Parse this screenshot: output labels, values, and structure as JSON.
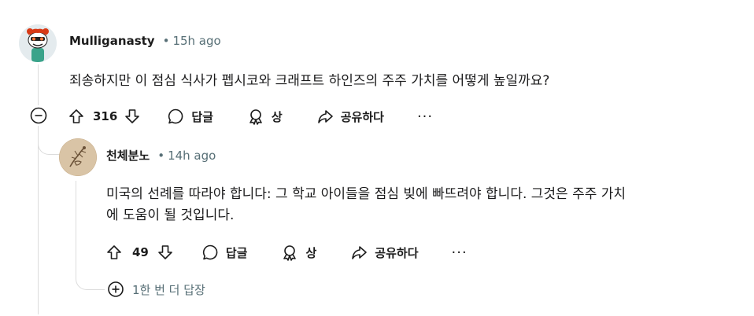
{
  "comment": {
    "author": "Mulliganasty",
    "time": "15h ago",
    "text": "죄송하지만 이 점심 식사가 펩시코와 크래프트 하인즈의 주주 가치를 어떻게 높일까요?",
    "votes": "316",
    "actions": {
      "reply": "답글",
      "award": "상",
      "share": "공유하다",
      "more": "···"
    }
  },
  "reply": {
    "author": "천체분노",
    "time": "14h ago",
    "text_line1": "미국의 선례를 따라야 합니다: 그 학교 아이들을 점심 빚에 빠뜨려야 합니다. 그것은 주주 가치",
    "text_line2": "에 도움이 될 것입니다.",
    "votes": "49",
    "actions": {
      "reply": "답글",
      "award": "상",
      "share": "공유하다",
      "more": "···"
    }
  },
  "more_replies": "1한 번 더 답장",
  "colors": {
    "meta": "#576f76",
    "text": "#1a1a1b",
    "line": "#dcdcdc"
  }
}
